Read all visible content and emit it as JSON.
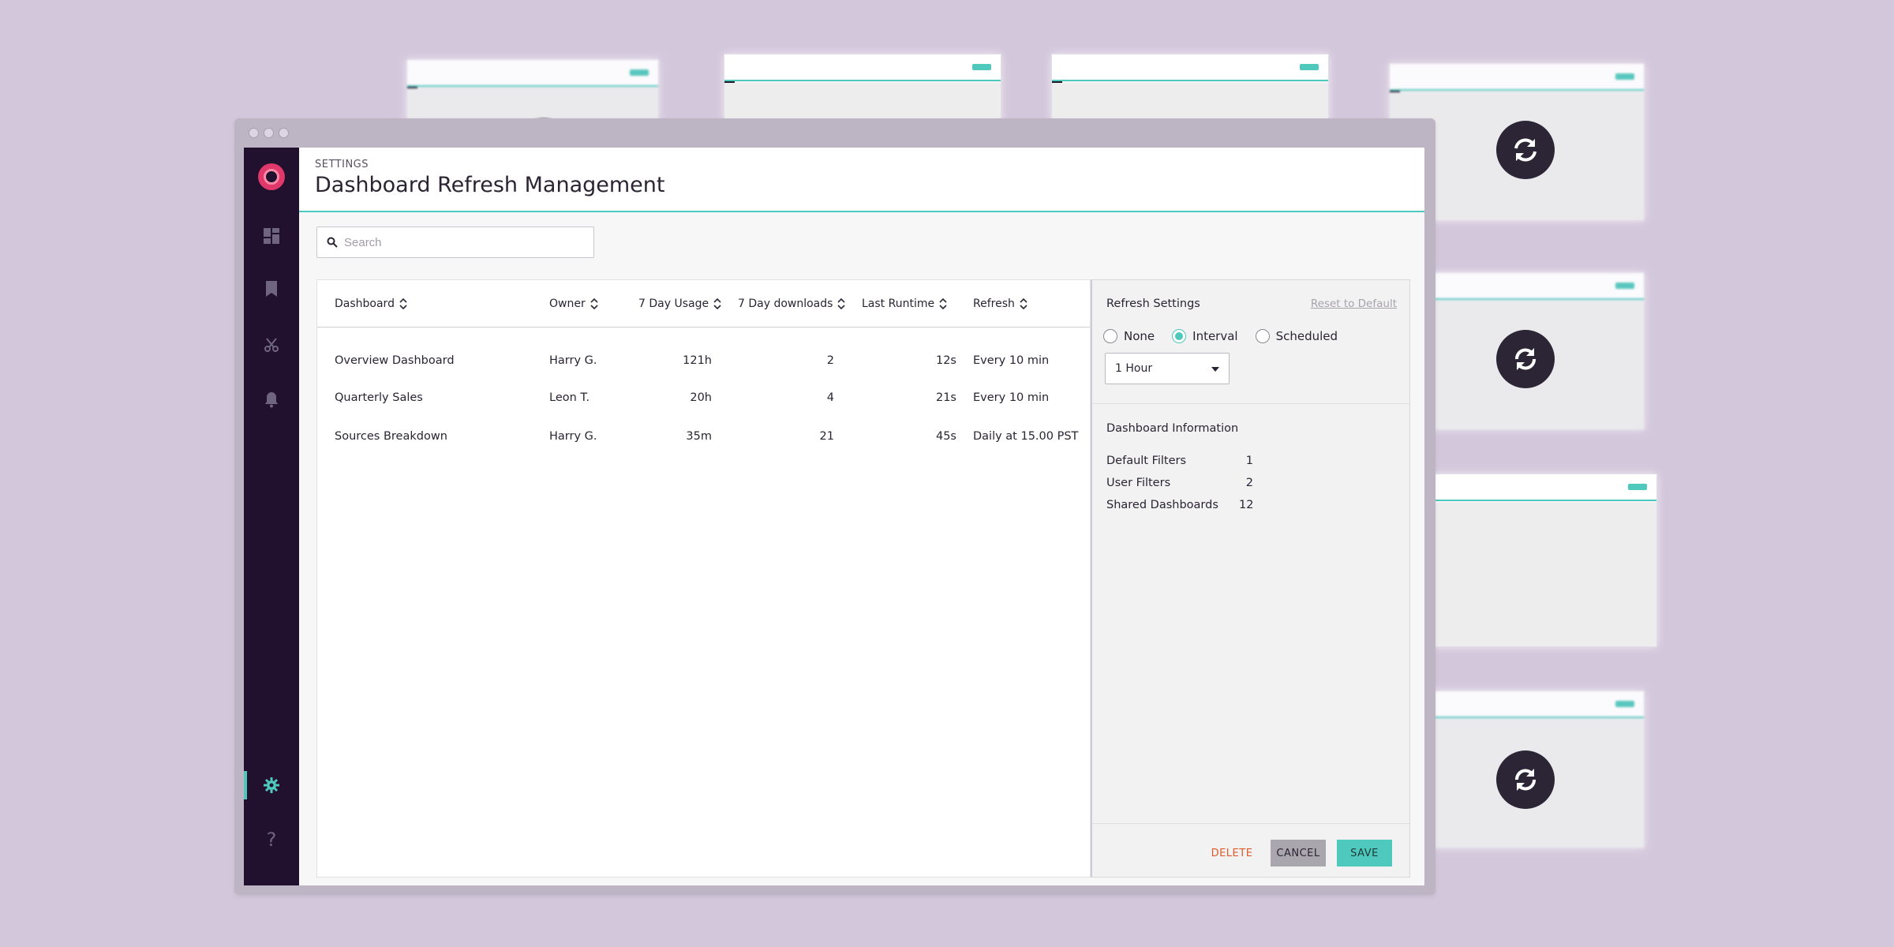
{
  "colors": {
    "background": "#d3c7dc",
    "accent": "#4fc8bd",
    "sidebar": "#22112e",
    "danger": "#e05a2b",
    "logo": "#e0386a"
  },
  "header": {
    "breadcrumb": "SETTINGS",
    "title": "Dashboard Refresh Management"
  },
  "search": {
    "placeholder": "Search"
  },
  "sidebar": {
    "items": [
      {
        "icon": "dashboard-icon"
      },
      {
        "icon": "bookmark-icon"
      },
      {
        "icon": "scissors-icon"
      },
      {
        "icon": "bell-icon"
      },
      {
        "icon": "gear-icon",
        "active": true
      },
      {
        "icon": "help-icon",
        "label": "?"
      }
    ]
  },
  "table": {
    "columns": [
      "Dashboard",
      "Owner",
      "7 Day Usage",
      "7 Day downloads",
      "Last Runtime",
      "Refresh"
    ],
    "rows": [
      {
        "dashboard": "Overview Dashboard",
        "owner": "Harry G.",
        "usage": "121h",
        "downloads": "2",
        "runtime": "12s",
        "refresh": "Every 10 min"
      },
      {
        "dashboard": "Quarterly Sales",
        "owner": "Leon T.",
        "usage": "20h",
        "downloads": "4",
        "runtime": "21s",
        "refresh": "Every 10 min"
      },
      {
        "dashboard": "Sources Breakdown",
        "owner": "Harry G.",
        "usage": "35m",
        "downloads": "21",
        "runtime": "45s",
        "refresh": "Daily at 15.00 PST"
      }
    ]
  },
  "refresh_settings": {
    "title": "Refresh Settings",
    "reset_label": "Reset to Default",
    "options": [
      "None",
      "Interval",
      "Scheduled"
    ],
    "selected_option": "Interval",
    "interval_value": "1 Hour"
  },
  "dashboard_info": {
    "title": "Dashboard Information",
    "rows": [
      {
        "label": "Default Filters",
        "value": "1"
      },
      {
        "label": "User Filters",
        "value": "2"
      },
      {
        "label": "Shared Dashboards",
        "value": "12"
      }
    ]
  },
  "actions": {
    "delete_label": "DELETE",
    "cancel_label": "CANCEL",
    "save_label": "SAVE"
  }
}
